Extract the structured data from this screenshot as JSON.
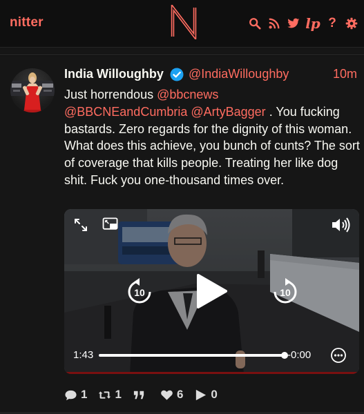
{
  "navbar": {
    "brand": "nitter",
    "logo_letter": "N",
    "icons": [
      "search-icon",
      "rss-icon",
      "twitter-icon",
      "liberapay-icon",
      "help-icon",
      "settings-icon"
    ],
    "help_glyph": "?",
    "liberapay_glyph": "lp"
  },
  "colors": {
    "accent": "#ff6c60",
    "background": "#0f0f0f",
    "panel": "#161616",
    "text": "#f8f8f2",
    "verified": "#1da1f2"
  },
  "tweet": {
    "fullname": "India Willoughby",
    "username": "@IndiaWilloughby",
    "timestamp": "10m",
    "verified": true,
    "content": {
      "part1": "Just horrendous ",
      "mention1": "@bbcnews",
      "mention2": "@BBCNEandCumbria",
      "sep": " ",
      "mention3": "@ArtyBagger",
      "part2": " . You fucking bastards.  Zero regards for the dignity of this woman. What does this achieve, you bunch of cunts? The sort of coverage that kills people. Treating her like dog shit. Fuck you one-thousand times over."
    },
    "video": {
      "current_time": "1:43",
      "remaining_time": "-0:00",
      "skip_seconds": "10",
      "progress": 1.0,
      "controls": [
        "fullscreen-icon",
        "picture-in-picture-icon",
        "volume-icon",
        "rewind-10-icon",
        "play-icon",
        "forward-10-icon",
        "more-options-icon"
      ]
    },
    "stats": {
      "replies": "1",
      "retweets": "1",
      "quotes": "",
      "likes": "6",
      "plays": "0"
    }
  }
}
